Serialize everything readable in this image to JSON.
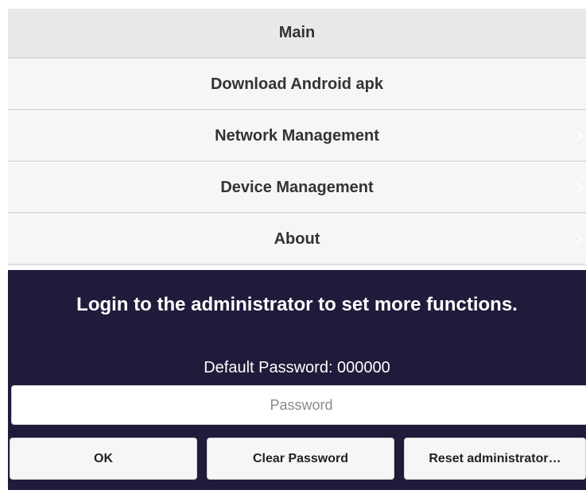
{
  "menu": {
    "items": [
      {
        "label": "Main"
      },
      {
        "label": "Download Android apk"
      },
      {
        "label": "Network Management"
      },
      {
        "label": "Device Management"
      },
      {
        "label": "About"
      }
    ]
  },
  "login": {
    "title": "Login to the administrator to set more functions.",
    "default_password": "Default Password: 000000",
    "password_placeholder": "Password",
    "buttons": {
      "ok": "OK",
      "clear": "Clear Password",
      "reset": "Reset administrator…"
    }
  },
  "colors": {
    "login_panel_bg": "#1f1b3a",
    "menu_bg": "#f6f6f6",
    "menu_main_bg": "#e9e9e9"
  }
}
